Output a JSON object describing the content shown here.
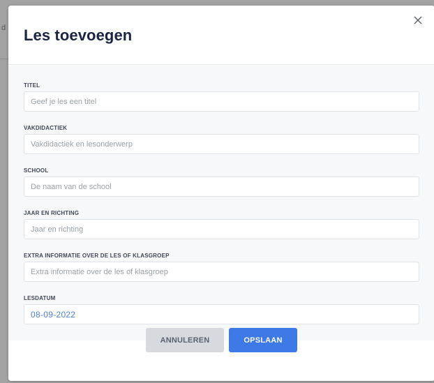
{
  "backdrop": {
    "edge_text": "d"
  },
  "modal": {
    "title": "Les toevoegen",
    "close_icon": "close-icon"
  },
  "form": {
    "fields": [
      {
        "label": "TITEL",
        "placeholder": "Geef je les een titel",
        "value": ""
      },
      {
        "label": "VAKDIDACTIEK",
        "placeholder": "Vakdidactiek en lesonderwerp",
        "value": ""
      },
      {
        "label": "SCHOOL",
        "placeholder": "De naam van de school",
        "value": ""
      },
      {
        "label": "JAAR EN RICHTING",
        "placeholder": "Jaar en richting",
        "value": ""
      },
      {
        "label": "EXTRA INFORMATIE OVER DE LES OF KLASGROEP",
        "placeholder": "Extra informatie over de les of klasgroep",
        "value": ""
      }
    ],
    "date": {
      "label": "LESDATUM",
      "value": "08-09-2022"
    }
  },
  "footer": {
    "cancel_label": "ANNULEREN",
    "save_label": "OPSLAAN"
  },
  "colors": {
    "primary": "#3d7ae6",
    "title": "#1b2440",
    "cancel_bg": "#d6dadf",
    "date_text": "#4e7fd6"
  }
}
